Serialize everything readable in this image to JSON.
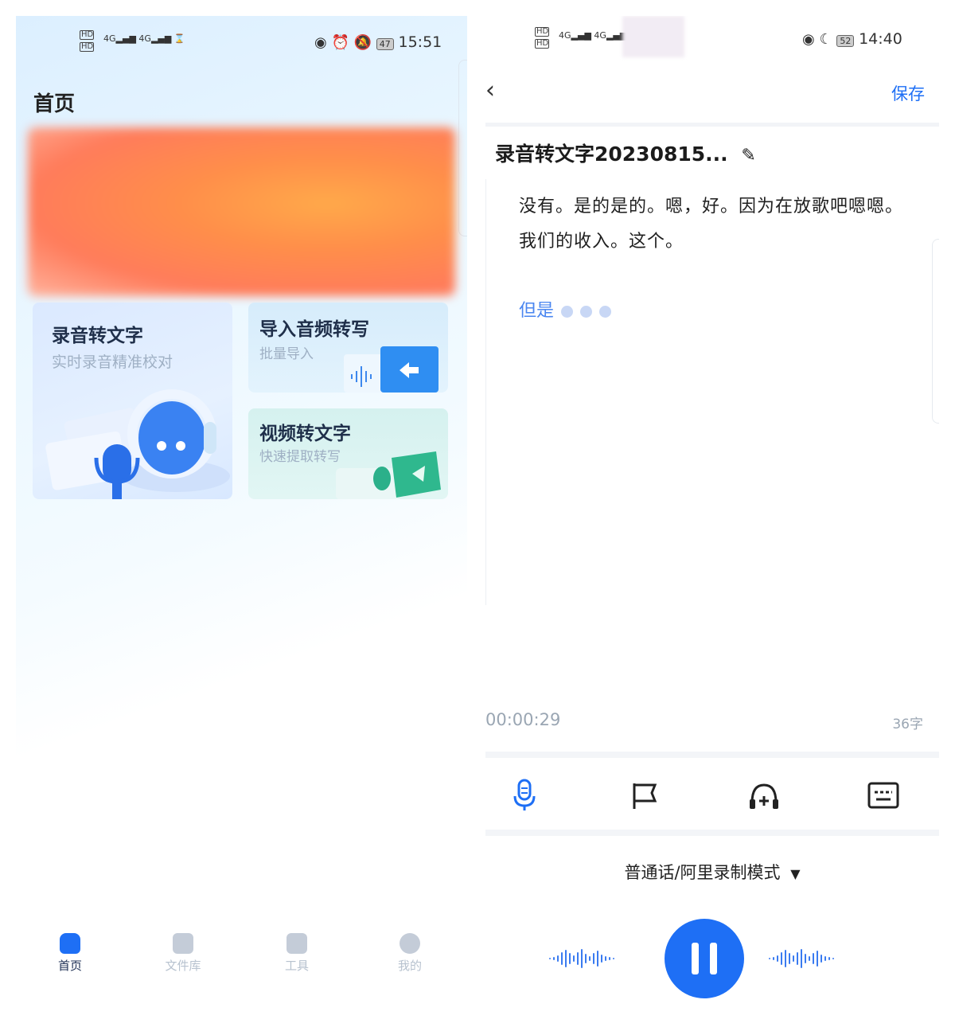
{
  "left": {
    "status": {
      "time": "15:51",
      "battery": "47",
      "net1": "4G",
      "net2": "4G"
    },
    "page_title": "首页",
    "cards": [
      {
        "title": "录音转文字",
        "subtitle": "实时录音精准校对"
      },
      {
        "title": "导入音频转写",
        "subtitle": "批量导入"
      },
      {
        "title": "视频转文字",
        "subtitle": "快速提取转写"
      }
    ],
    "tabs": [
      {
        "label": "首页",
        "icon": "home-icon",
        "active": true
      },
      {
        "label": "文件库",
        "icon": "file-icon",
        "active": false
      },
      {
        "label": "工具",
        "icon": "toolbox-icon",
        "active": false
      },
      {
        "label": "我的",
        "icon": "profile-icon",
        "active": false
      }
    ],
    "colors": {
      "accent": "#1e6ff5",
      "tab_inactive": "#b7c2cf"
    }
  },
  "right": {
    "status": {
      "time": "14:40",
      "battery": "52",
      "net1": "4G",
      "net2": "4G"
    },
    "save_label": "保存",
    "doc_title": "录音转文字20230815...",
    "transcript": "没有。是的是的。嗯，好。因为在放歌吧嗯嗯。我们的收入。这个。",
    "live_text": "但是",
    "timer": "00:00:29",
    "char_count": "36字",
    "mode_label": "普通话/阿里录制模式",
    "toolbar": [
      "mic-icon",
      "flag-icon",
      "headset-icon",
      "keyboard-icon"
    ],
    "colors": {
      "accent": "#1e6ff5",
      "live_text": "#4a86f0"
    }
  }
}
